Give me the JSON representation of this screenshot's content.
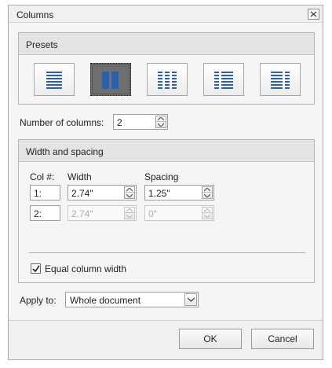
{
  "window": {
    "title": "Columns"
  },
  "presets": {
    "title": "Presets",
    "items": [
      {
        "name": "one-column",
        "selected": false
      },
      {
        "name": "two-columns",
        "selected": true
      },
      {
        "name": "three-columns",
        "selected": false
      },
      {
        "name": "left-column",
        "selected": false
      },
      {
        "name": "right-column",
        "selected": false
      }
    ]
  },
  "number_of_columns": {
    "label": "Number of columns:",
    "value": "2"
  },
  "width_spacing": {
    "title": "Width and spacing",
    "headers": {
      "col": "Col #:",
      "width": "Width",
      "spacing": "Spacing"
    },
    "rows": [
      {
        "col": "1:",
        "width": "2.74\"",
        "spacing": "1.25\"",
        "enabled": true
      },
      {
        "col": "2:",
        "width": "2.74\"",
        "spacing": "0\"",
        "enabled": false
      }
    ],
    "equal_width": {
      "label": "Equal column width",
      "checked": true
    }
  },
  "apply_to": {
    "label": "Apply to:",
    "value": "Whole document"
  },
  "buttons": {
    "ok": "OK",
    "cancel": "Cancel"
  },
  "colors": {
    "icon_blue": "#2e5fa8",
    "selected_bg": "#6f6f6f"
  }
}
